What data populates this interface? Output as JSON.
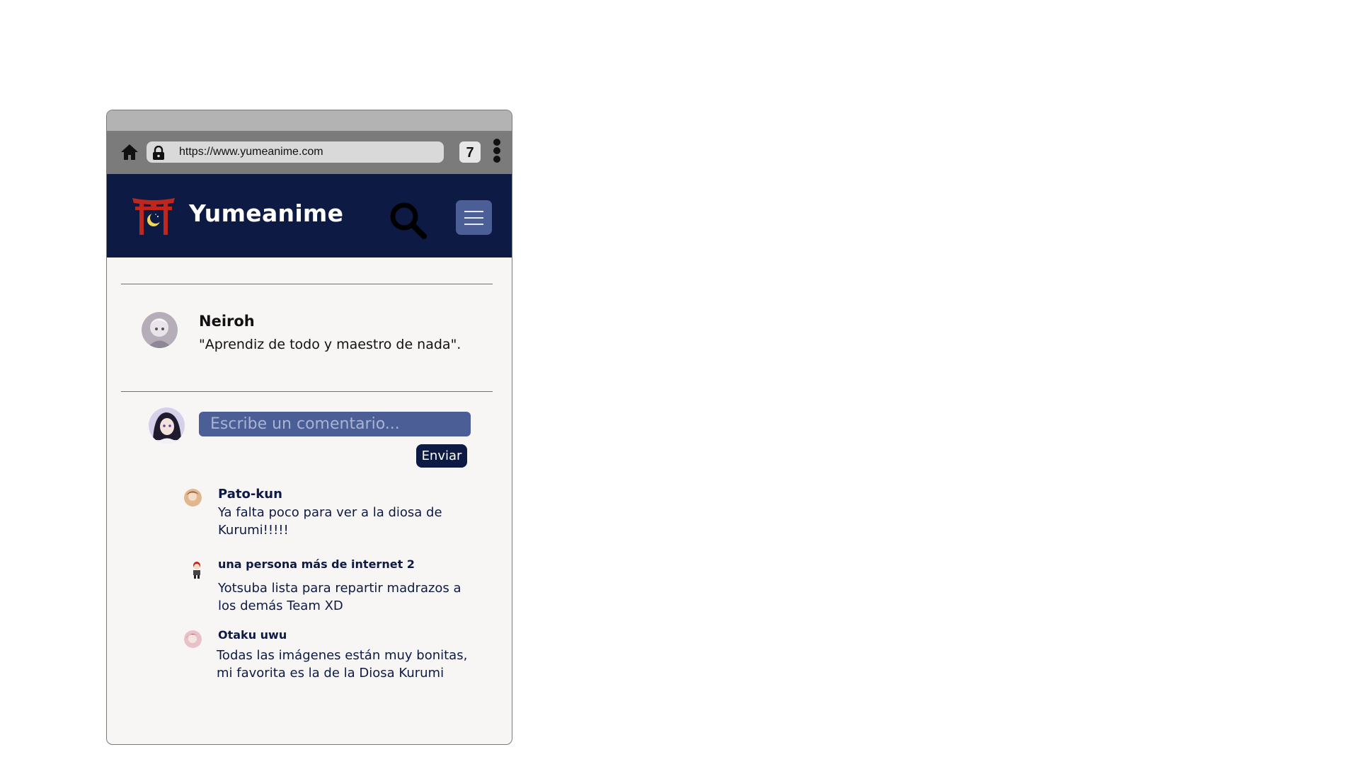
{
  "browser": {
    "url": "https://www.yumeanime.com",
    "tab_count": "7"
  },
  "header": {
    "brand": "Yumeanime"
  },
  "profile": {
    "name": "Neiroh",
    "quote": "\"Aprendiz de todo y maestro de nada\"."
  },
  "composer": {
    "placeholder": "Escribe un comentario...",
    "send_label": "Enviar"
  },
  "comments": [
    {
      "author": "Pato-kun",
      "text": "Ya falta poco para ver a la diosa de Kurumi!!!!!"
    },
    {
      "author": "una persona más de internet 2",
      "text": "Yotsuba lista para repartir madrazos a los demás Team XD"
    },
    {
      "author": "Otaku uwu",
      "text": "Todas las imágenes están muy bonitas, mi favorita es la de la Diosa Kurumi"
    }
  ],
  "colors": {
    "navy": "#0d1a44",
    "input_blue": "#4b5f96",
    "torii_red": "#c0271c",
    "moon_yellow": "#f2d45a"
  }
}
